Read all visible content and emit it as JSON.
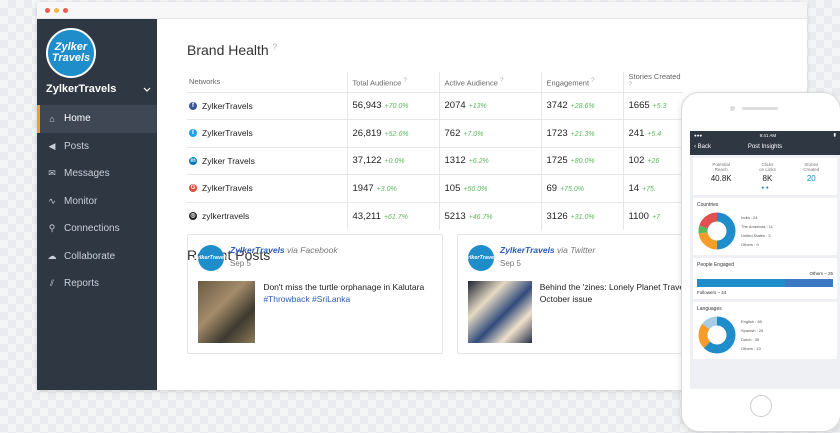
{
  "app": {
    "account_name": "ZylkerTravels",
    "logo_line1": "Zylker",
    "logo_line2": "Travels"
  },
  "sidebar": {
    "items": [
      {
        "label": "Home",
        "icon": "home-icon",
        "active": true
      },
      {
        "label": "Posts",
        "icon": "megaphone-icon"
      },
      {
        "label": "Messages",
        "icon": "envelope-icon"
      },
      {
        "label": "Monitor",
        "icon": "pulse-icon"
      },
      {
        "label": "Connections",
        "icon": "link-icon"
      },
      {
        "label": "Collaborate",
        "icon": "chat-icon"
      },
      {
        "label": "Reports",
        "icon": "chart-icon"
      }
    ]
  },
  "brand_health": {
    "title": "Brand Health",
    "columns": [
      "Networks",
      "Total Audience",
      "Active Audience",
      "Engagement",
      "Stories Created"
    ],
    "rows": [
      {
        "network": "ZylkerTravels",
        "icon": "facebook-icon",
        "color": "#3b5998",
        "total": "56,943",
        "total_d": "+70.0%",
        "active": "2074",
        "active_d": "+13%",
        "eng": "3742",
        "eng_d": "+28.6%",
        "stories": "1665",
        "stories_d": "+5.3"
      },
      {
        "network": "ZylkerTravels",
        "icon": "twitter-icon",
        "color": "#1da1f2",
        "total": "26,819",
        "total_d": "+52.6%",
        "active": "762",
        "active_d": "+7.0%",
        "eng": "1723",
        "eng_d": "+21.3%",
        "stories": "241",
        "stories_d": "+5.4"
      },
      {
        "network": "Zylker Travels",
        "icon": "linkedin-icon",
        "color": "#0077b5",
        "total": "37,122",
        "total_d": "+0.0%",
        "active": "1312",
        "active_d": "+6.2%",
        "eng": "1725",
        "eng_d": "+80.0%",
        "stories": "102",
        "stories_d": "+26"
      },
      {
        "network": "ZylkerTravels",
        "icon": "googleplus-icon",
        "color": "#dd4b39",
        "total": "1947",
        "total_d": "+3.0%",
        "active": "105",
        "active_d": "+50.0%",
        "eng": "69",
        "eng_d": "+75.0%",
        "stories": "14",
        "stories_d": "+75."
      },
      {
        "network": "zylkertravels",
        "icon": "instagram-icon",
        "color": "#222222",
        "total": "43,211",
        "total_d": "+61.7%",
        "active": "5213",
        "active_d": "+46.7%",
        "eng": "3126",
        "eng_d": "+31.0%",
        "stories": "1100",
        "stories_d": "+7"
      }
    ]
  },
  "recent_posts": {
    "title": "Recent Posts",
    "posts": [
      {
        "author": "ZylkerTravels",
        "via": "via Facebook",
        "date": "Sep 5",
        "text_plain": "Don't miss the turtle orphanage in Kalutara ",
        "tags": "#Throwback #SriLanka"
      },
      {
        "author": "ZylkerTravels",
        "via": "via Twitter",
        "date": "Sep 5",
        "text_plain": "Behind the 'zines: Lonely Planet Traveller's October issue",
        "tags": ""
      }
    ]
  },
  "phone": {
    "status_time": "9:41 AM",
    "back_label": "Back",
    "title": "Post Insights",
    "stats": [
      {
        "label1": "Potential",
        "label2": "Reach",
        "value": "40.8K"
      },
      {
        "label1": "Clicks",
        "label2": "on Links",
        "value": "8K"
      },
      {
        "label1": "Stories",
        "label2": "Created",
        "value": "20"
      }
    ],
    "countries_title": "Countries",
    "countries": [
      "India : 24",
      "The Americas : 11",
      "United States : 3",
      "Others : 9"
    ],
    "people_title": "People Engaged",
    "others_label": "Others – 25",
    "followers_label": "Followers – 44",
    "languages_title": "Languages",
    "languages": [
      "English : 65",
      "Spanish : 25",
      "Dutch : 35",
      "Others : 10"
    ],
    "colors": [
      "#1f8dc9",
      "#f59c2a",
      "#5cb85c",
      "#e8e8e8"
    ]
  }
}
